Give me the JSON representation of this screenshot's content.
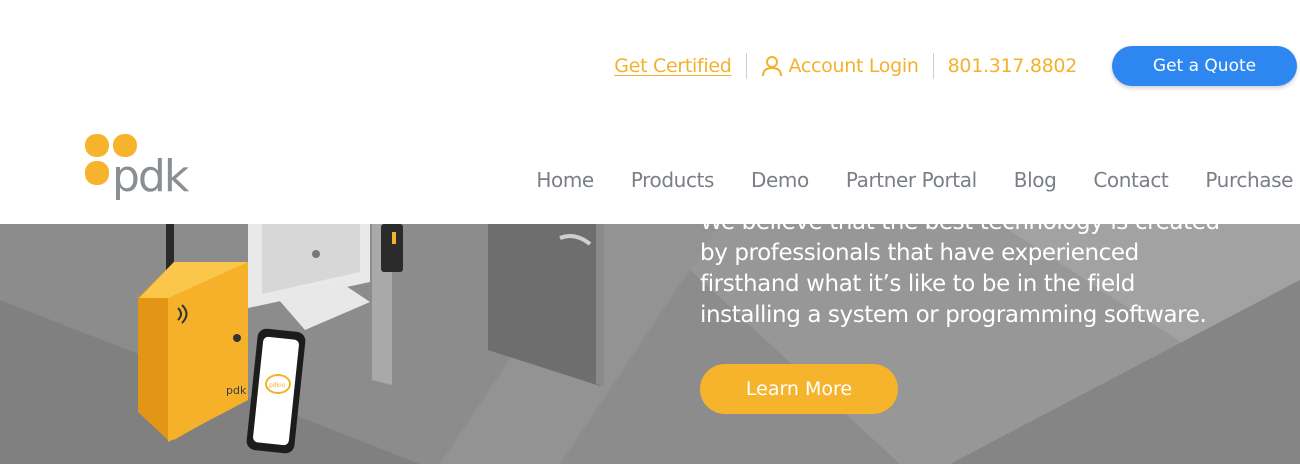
{
  "colors": {
    "brand_orange": "#f6b42c",
    "quote_blue": "#2e86f0",
    "nav_gray": "#7a7f86"
  },
  "topbar": {
    "certified_label": "Get Certified",
    "login_icon": "user-icon",
    "login_label": "Account Login",
    "phone": "801.317.8802",
    "quote_label": "Get a Quote"
  },
  "logo": {
    "text": "pdk"
  },
  "nav": {
    "items": [
      "Home",
      "Products",
      "Demo",
      "Partner Portal",
      "Blog",
      "Contact",
      "Purchase"
    ]
  },
  "hero": {
    "body": "We believe that the best technology is created by professionals that have experienced firsthand what it’s like to be in the field installing a system or programming software.",
    "cta_label": "Learn More",
    "phone_app_text": "pdkio",
    "panel_text": "pdk"
  }
}
